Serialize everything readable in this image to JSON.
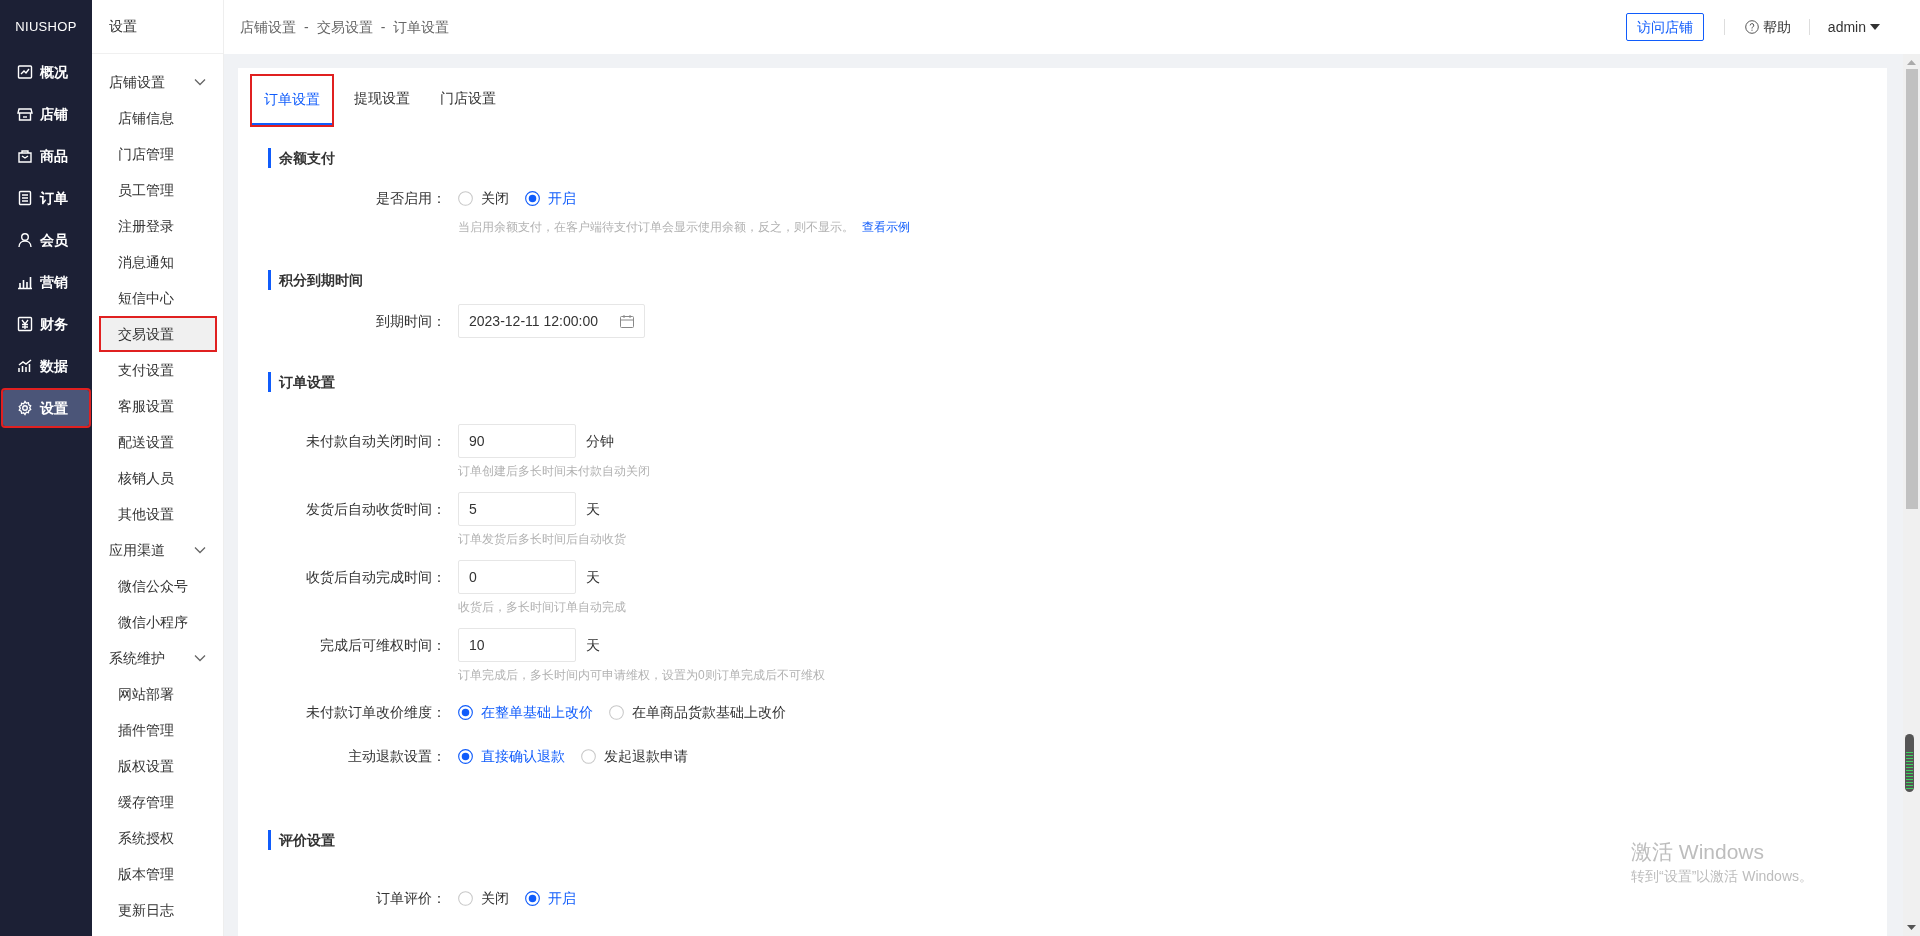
{
  "logo": "NIUSHOP",
  "nav": [
    {
      "label": "概况",
      "selected": false,
      "highlighted": false
    },
    {
      "label": "店铺",
      "selected": false,
      "highlighted": false
    },
    {
      "label": "商品",
      "selected": false,
      "highlighted": false
    },
    {
      "label": "订单",
      "selected": false,
      "highlighted": false
    },
    {
      "label": "会员",
      "selected": false,
      "highlighted": false
    },
    {
      "label": "营销",
      "selected": false,
      "highlighted": false
    },
    {
      "label": "财务",
      "selected": false,
      "highlighted": false
    },
    {
      "label": "数据",
      "selected": false,
      "highlighted": false
    },
    {
      "label": "设置",
      "selected": true,
      "highlighted": true
    }
  ],
  "subnav": {
    "title": "设置",
    "groups": [
      {
        "label": "店铺设置",
        "expanded": true,
        "children": [
          {
            "label": "店铺信息",
            "selected": false,
            "highlighted": false
          },
          {
            "label": "门店管理",
            "selected": false,
            "highlighted": false
          },
          {
            "label": "员工管理",
            "selected": false,
            "highlighted": false
          },
          {
            "label": "注册登录",
            "selected": false,
            "highlighted": false
          },
          {
            "label": "消息通知",
            "selected": false,
            "highlighted": false
          },
          {
            "label": "短信中心",
            "selected": false,
            "highlighted": false
          },
          {
            "label": "交易设置",
            "selected": true,
            "highlighted": true
          },
          {
            "label": "支付设置",
            "selected": false,
            "highlighted": false
          },
          {
            "label": "客服设置",
            "selected": false,
            "highlighted": false
          },
          {
            "label": "配送设置",
            "selected": false,
            "highlighted": false
          },
          {
            "label": "核销人员",
            "selected": false,
            "highlighted": false
          },
          {
            "label": "其他设置",
            "selected": false,
            "highlighted": false
          }
        ]
      },
      {
        "label": "应用渠道",
        "expanded": true,
        "children": [
          {
            "label": "微信公众号",
            "selected": false,
            "highlighted": false
          },
          {
            "label": "微信小程序",
            "selected": false,
            "highlighted": false
          }
        ]
      },
      {
        "label": "系统维护",
        "expanded": true,
        "children": [
          {
            "label": "网站部署",
            "selected": false,
            "highlighted": false
          },
          {
            "label": "插件管理",
            "selected": false,
            "highlighted": false
          },
          {
            "label": "版权设置",
            "selected": false,
            "highlighted": false
          },
          {
            "label": "缓存管理",
            "selected": false,
            "highlighted": false
          },
          {
            "label": "系统授权",
            "selected": false,
            "highlighted": false
          },
          {
            "label": "版本管理",
            "selected": false,
            "highlighted": false
          },
          {
            "label": "更新日志",
            "selected": false,
            "highlighted": false
          }
        ]
      }
    ]
  },
  "breadcrumb": {
    "items": [
      "店铺设置",
      "交易设置",
      "订单设置"
    ],
    "separator": "-"
  },
  "header": {
    "visit_button": "访问店铺",
    "help": "帮助",
    "user": "admin"
  },
  "tabs": [
    {
      "label": "订单设置",
      "selected": true,
      "highlighted": true
    },
    {
      "label": "提现设置",
      "selected": false,
      "highlighted": false
    },
    {
      "label": "门店设置",
      "selected": false,
      "highlighted": false
    }
  ],
  "sections": [
    {
      "title": "余额支付",
      "rows": [
        {
          "kind": "radio",
          "label": "是否启用：",
          "options": [
            {
              "label": "关闭",
              "selected": false
            },
            {
              "label": "开启",
              "selected": true
            }
          ],
          "help": "当启用余额支付，在客户端待支付订单会显示使用余额，反之，则不显示。",
          "help_link": "查看示例"
        }
      ]
    },
    {
      "title": "积分到期时间",
      "rows": [
        {
          "kind": "date",
          "label": "到期时间：",
          "value": "2023-12-11 12:00:00"
        }
      ]
    },
    {
      "title": "订单设置",
      "rows": [
        {
          "kind": "number",
          "label": "未付款自动关闭时间：",
          "value": "90",
          "unit": "分钟",
          "help": "订单创建后多长时间未付款自动关闭"
        },
        {
          "kind": "number",
          "label": "发货后自动收货时间：",
          "value": "5",
          "unit": "天",
          "help": "订单发货后多长时间后自动收货"
        },
        {
          "kind": "number",
          "label": "收货后自动完成时间：",
          "value": "0",
          "unit": "天",
          "help": "收货后，多长时间订单自动完成"
        },
        {
          "kind": "number",
          "label": "完成后可维权时间：",
          "value": "10",
          "unit": "天",
          "help": "订单完成后，多长时间内可申请维权，设置为0则订单完成后不可维权"
        },
        {
          "kind": "radio",
          "label": "未付款订单改价维度：",
          "options": [
            {
              "label": "在整单基础上改价",
              "selected": true
            },
            {
              "label": "在单商品货款基础上改价",
              "selected": false
            }
          ]
        },
        {
          "kind": "radio",
          "label": "主动退款设置：",
          "options": [
            {
              "label": "直接确认退款",
              "selected": true
            },
            {
              "label": "发起退款申请",
              "selected": false
            }
          ]
        }
      ]
    },
    {
      "title": "评价设置",
      "rows": [
        {
          "kind": "radio",
          "label": "订单评价：",
          "options": [
            {
              "label": "关闭",
              "selected": false
            },
            {
              "label": "开启",
              "selected": true
            }
          ]
        }
      ]
    }
  ],
  "watermark": {
    "title": "激活 Windows",
    "subtitle": "转到“设置”以激活 Windows。"
  }
}
